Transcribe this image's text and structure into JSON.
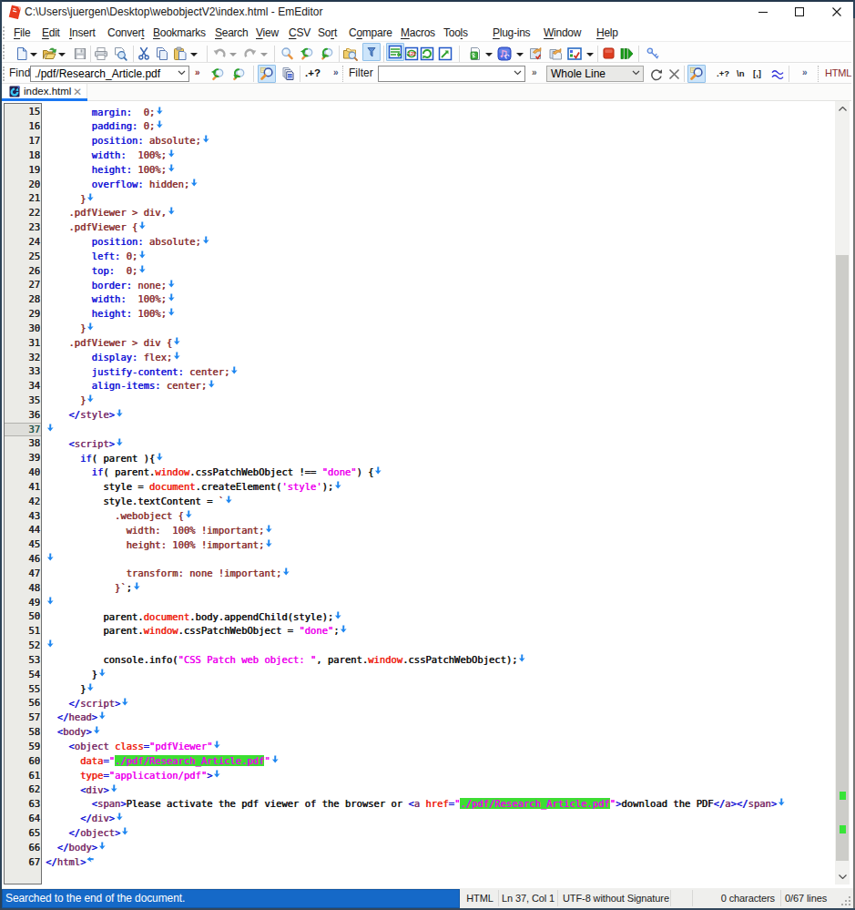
{
  "window": {
    "title": "C:\\Users\\juergen\\Desktop\\webobjectV2\\index.html - EmEditor",
    "controls": [
      "minimize",
      "maximize",
      "close"
    ]
  },
  "menu": {
    "items": [
      {
        "pre": "",
        "key": "F",
        "post": "ile"
      },
      {
        "pre": "",
        "key": "E",
        "post": "dit"
      },
      {
        "pre": "",
        "key": "I",
        "post": "nsert"
      },
      {
        "pre": "Conver",
        "key": "t",
        "post": ""
      },
      {
        "pre": "",
        "key": "B",
        "post": "ookmarks"
      },
      {
        "pre": "",
        "key": "S",
        "post": "earch"
      },
      {
        "pre": "",
        "key": "V",
        "post": "iew"
      },
      {
        "pre": "",
        "key": "C",
        "post": "SV"
      },
      {
        "pre": "So",
        "key": "r",
        "post": "t"
      },
      {
        "pre": "C",
        "key": "o",
        "post": "mpare"
      },
      {
        "pre": "",
        "key": "M",
        "post": "acros"
      },
      {
        "pre": "Too",
        "key": "l",
        "post": "s"
      },
      {
        "pre": "",
        "key": "P",
        "post": "lug-ins"
      },
      {
        "pre": "",
        "key": "W",
        "post": "indow"
      },
      {
        "pre": "",
        "key": "H",
        "post": "elp"
      }
    ]
  },
  "toolbar": {
    "icons": [
      "new-file",
      "open-file",
      "save",
      "print",
      "print-preview",
      "cut",
      "copy",
      "paste",
      "undo",
      "redo",
      "find",
      "find-next",
      "find-previous",
      "find-in-files",
      "filter",
      "wrap-indicator",
      "csv-mode",
      "reload",
      "jump",
      "snippets",
      "macros",
      "record-macro",
      "run-macro",
      "macro-options",
      "stop",
      "pause-run",
      "pin"
    ]
  },
  "findbar": {
    "find_label": "Find",
    "find_value": "./pdf/Research_Article.pdf",
    "filter_label": "Filter",
    "filter_value": "",
    "match_mode": "Whole Line",
    "badge_regex": ".+?",
    "badge_regex2": ".+?",
    "badge_newline": "\\n",
    "badge_brackets": "[,]",
    "syntax_badge": "HTML"
  },
  "tabs": [
    {
      "label": "index.html",
      "active": true
    }
  ],
  "editor": {
    "first_line": 15,
    "current_line": 37,
    "lines": [
      {
        "n": 15,
        "seg": [
          [
            "w",
            "        "
          ],
          [
            "p",
            "margin:"
          ],
          [
            "w",
            "  "
          ],
          [
            "v",
            "0;"
          ]
        ]
      },
      {
        "n": 16,
        "seg": [
          [
            "w",
            "        "
          ],
          [
            "p",
            "padding:"
          ],
          [
            "w",
            " "
          ],
          [
            "v",
            "0;"
          ]
        ]
      },
      {
        "n": 17,
        "seg": [
          [
            "w",
            "        "
          ],
          [
            "p",
            "position:"
          ],
          [
            "w",
            " "
          ],
          [
            "v",
            "absolute;"
          ]
        ]
      },
      {
        "n": 18,
        "seg": [
          [
            "w",
            "        "
          ],
          [
            "p",
            "width:"
          ],
          [
            "w",
            "  "
          ],
          [
            "v",
            "100%;"
          ]
        ]
      },
      {
        "n": 19,
        "seg": [
          [
            "w",
            "        "
          ],
          [
            "p",
            "height:"
          ],
          [
            "w",
            " "
          ],
          [
            "v",
            "100%;"
          ]
        ]
      },
      {
        "n": 20,
        "seg": [
          [
            "w",
            "        "
          ],
          [
            "p",
            "overflow:"
          ],
          [
            "w",
            " "
          ],
          [
            "v",
            "hidden;"
          ]
        ]
      },
      {
        "n": 21,
        "seg": [
          [
            "w",
            "      "
          ],
          [
            "v",
            "}"
          ]
        ]
      },
      {
        "n": 22,
        "seg": [
          [
            "w",
            "    "
          ],
          [
            "v",
            ".pdfViewer > div,"
          ]
        ]
      },
      {
        "n": 23,
        "seg": [
          [
            "w",
            "    "
          ],
          [
            "v",
            ".pdfViewer {"
          ]
        ]
      },
      {
        "n": 24,
        "seg": [
          [
            "w",
            "        "
          ],
          [
            "p",
            "position:"
          ],
          [
            "w",
            " "
          ],
          [
            "v",
            "absolute;"
          ]
        ]
      },
      {
        "n": 25,
        "seg": [
          [
            "w",
            "        "
          ],
          [
            "p",
            "left:"
          ],
          [
            "w",
            " "
          ],
          [
            "v",
            "0;"
          ]
        ]
      },
      {
        "n": 26,
        "seg": [
          [
            "w",
            "        "
          ],
          [
            "p",
            "top:"
          ],
          [
            "w",
            "  "
          ],
          [
            "v",
            "0;"
          ]
        ]
      },
      {
        "n": 27,
        "seg": [
          [
            "w",
            "        "
          ],
          [
            "p",
            "border:"
          ],
          [
            "w",
            " "
          ],
          [
            "v",
            "none;"
          ]
        ]
      },
      {
        "n": 28,
        "seg": [
          [
            "w",
            "        "
          ],
          [
            "p",
            "width:"
          ],
          [
            "w",
            "  "
          ],
          [
            "v",
            "100%;"
          ]
        ]
      },
      {
        "n": 29,
        "seg": [
          [
            "w",
            "        "
          ],
          [
            "p",
            "height:"
          ],
          [
            "w",
            " "
          ],
          [
            "v",
            "100%;"
          ]
        ]
      },
      {
        "n": 30,
        "seg": [
          [
            "w",
            "      "
          ],
          [
            "v",
            "}"
          ]
        ]
      },
      {
        "n": 31,
        "seg": [
          [
            "w",
            "    "
          ],
          [
            "v",
            ".pdfViewer > div {"
          ]
        ]
      },
      {
        "n": 32,
        "seg": [
          [
            "w",
            "        "
          ],
          [
            "p",
            "display:"
          ],
          [
            "w",
            " "
          ],
          [
            "v",
            "flex;"
          ]
        ]
      },
      {
        "n": 33,
        "seg": [
          [
            "w",
            "        "
          ],
          [
            "p",
            "justify-content:"
          ],
          [
            "w",
            " "
          ],
          [
            "v",
            "center;"
          ]
        ]
      },
      {
        "n": 34,
        "seg": [
          [
            "w",
            "        "
          ],
          [
            "p",
            "align-items:"
          ],
          [
            "w",
            " "
          ],
          [
            "v",
            "center;"
          ]
        ]
      },
      {
        "n": 35,
        "seg": [
          [
            "w",
            "      "
          ],
          [
            "v",
            "}"
          ]
        ]
      },
      {
        "n": 36,
        "seg": [
          [
            "w",
            "    "
          ],
          [
            "p",
            "</"
          ],
          [
            "t",
            "style"
          ],
          [
            "p",
            ">"
          ]
        ]
      },
      {
        "n": 37,
        "seg": []
      },
      {
        "n": 38,
        "seg": [
          [
            "w",
            "    "
          ],
          [
            "p",
            "<"
          ],
          [
            "t",
            "script"
          ],
          [
            "p",
            ">"
          ]
        ]
      },
      {
        "n": 39,
        "seg": [
          [
            "w",
            "      "
          ],
          [
            "p",
            "if"
          ],
          [
            "b",
            "( parent ){"
          ]
        ]
      },
      {
        "n": 40,
        "seg": [
          [
            "w",
            "        "
          ],
          [
            "p",
            "if"
          ],
          [
            "b",
            "( parent."
          ],
          [
            "r",
            "window"
          ],
          [
            "b",
            ".cssPatchWebObject !== "
          ],
          [
            "s",
            "\"done\""
          ],
          [
            "b",
            ") {"
          ]
        ]
      },
      {
        "n": 41,
        "seg": [
          [
            "w",
            "          "
          ],
          [
            "b",
            "style = "
          ],
          [
            "r",
            "document"
          ],
          [
            "b",
            ".createElement("
          ],
          [
            "s",
            "'style'"
          ],
          [
            "b",
            ");"
          ]
        ]
      },
      {
        "n": 42,
        "seg": [
          [
            "w",
            "          "
          ],
          [
            "b",
            "style.textContent = "
          ],
          [
            "v",
            "`"
          ]
        ]
      },
      {
        "n": 43,
        "seg": [
          [
            "w",
            "            "
          ],
          [
            "v",
            ".webobject {"
          ]
        ]
      },
      {
        "n": 44,
        "seg": [
          [
            "w",
            "              "
          ],
          [
            "v",
            "width:  100% !important;"
          ]
        ]
      },
      {
        "n": 45,
        "seg": [
          [
            "w",
            "              "
          ],
          [
            "v",
            "height: 100% !important;"
          ]
        ]
      },
      {
        "n": 46,
        "seg": []
      },
      {
        "n": 47,
        "seg": [
          [
            "w",
            "              "
          ],
          [
            "v",
            "transform: none !important;"
          ]
        ]
      },
      {
        "n": 48,
        "seg": [
          [
            "w",
            "            "
          ],
          [
            "v",
            "}`"
          ],
          [
            "b",
            ";"
          ]
        ]
      },
      {
        "n": 49,
        "seg": []
      },
      {
        "n": 50,
        "seg": [
          [
            "w",
            "          "
          ],
          [
            "b",
            "parent."
          ],
          [
            "r",
            "document"
          ],
          [
            "b",
            ".body.appendChild(style);"
          ]
        ]
      },
      {
        "n": 51,
        "seg": [
          [
            "w",
            "          "
          ],
          [
            "b",
            "parent."
          ],
          [
            "r",
            "window"
          ],
          [
            "b",
            ".cssPatchWebObject = "
          ],
          [
            "s",
            "\"done\""
          ],
          [
            "b",
            ";"
          ]
        ]
      },
      {
        "n": 52,
        "seg": []
      },
      {
        "n": 53,
        "seg": [
          [
            "w",
            "          "
          ],
          [
            "b",
            "console.info("
          ],
          [
            "s",
            "\"CSS Patch web object: \""
          ],
          [
            "b",
            ", parent."
          ],
          [
            "r",
            "window"
          ],
          [
            "b",
            ".cssPatchWebObject);"
          ]
        ]
      },
      {
        "n": 54,
        "seg": [
          [
            "w",
            "        "
          ],
          [
            "b",
            "}"
          ]
        ]
      },
      {
        "n": 55,
        "seg": [
          [
            "w",
            "      "
          ],
          [
            "b",
            "}"
          ]
        ]
      },
      {
        "n": 56,
        "seg": [
          [
            "w",
            "    "
          ],
          [
            "p",
            "</"
          ],
          [
            "t",
            "script"
          ],
          [
            "p",
            ">"
          ]
        ]
      },
      {
        "n": 57,
        "seg": [
          [
            "w",
            "  "
          ],
          [
            "p",
            "</"
          ],
          [
            "t",
            "head"
          ],
          [
            "p",
            ">"
          ]
        ]
      },
      {
        "n": 58,
        "seg": [
          [
            "w",
            "  "
          ],
          [
            "p",
            "<"
          ],
          [
            "t",
            "body"
          ],
          [
            "p",
            ">"
          ]
        ]
      },
      {
        "n": 59,
        "seg": [
          [
            "w",
            "    "
          ],
          [
            "p",
            "<"
          ],
          [
            "t",
            "object"
          ],
          [
            "b",
            " "
          ],
          [
            "r",
            "class"
          ],
          [
            "p",
            "="
          ],
          [
            "s",
            "\"pdfViewer\""
          ]
        ]
      },
      {
        "n": 60,
        "seg": [
          [
            "w",
            "      "
          ],
          [
            "r",
            "data"
          ],
          [
            "p",
            "="
          ],
          [
            "s",
            "\""
          ],
          [
            "g",
            "./pdf/Research_Article.pdf"
          ],
          [
            "s",
            "\""
          ]
        ]
      },
      {
        "n": 61,
        "seg": [
          [
            "w",
            "      "
          ],
          [
            "r",
            "type"
          ],
          [
            "p",
            "="
          ],
          [
            "s",
            "\"application/pdf\""
          ],
          [
            "p",
            ">"
          ]
        ]
      },
      {
        "n": 62,
        "seg": [
          [
            "w",
            "      "
          ],
          [
            "p",
            "<"
          ],
          [
            "t",
            "div"
          ],
          [
            "p",
            ">"
          ]
        ]
      },
      {
        "n": 63,
        "seg": [
          [
            "w",
            "        "
          ],
          [
            "p",
            "<"
          ],
          [
            "t",
            "span"
          ],
          [
            "p",
            ">"
          ],
          [
            "b",
            "Please activate the pdf viewer of the browser or "
          ],
          [
            "p",
            "<"
          ],
          [
            "t",
            "a"
          ],
          [
            "b",
            " "
          ],
          [
            "r",
            "href"
          ],
          [
            "p",
            "="
          ],
          [
            "s",
            "\""
          ],
          [
            "g",
            "./pdf/Research_Article.pdf"
          ],
          [
            "s",
            "\""
          ],
          [
            "p",
            ">"
          ],
          [
            "b",
            "download the PDF"
          ],
          [
            "p",
            "</"
          ],
          [
            "t",
            "a"
          ],
          [
            "p",
            ">"
          ],
          [
            "p",
            "</"
          ],
          [
            "t",
            "span"
          ],
          [
            "p",
            ">"
          ]
        ]
      },
      {
        "n": 64,
        "seg": [
          [
            "w",
            "      "
          ],
          [
            "p",
            "</"
          ],
          [
            "t",
            "div"
          ],
          [
            "p",
            ">"
          ]
        ]
      },
      {
        "n": 65,
        "seg": [
          [
            "w",
            "    "
          ],
          [
            "p",
            "</"
          ],
          [
            "t",
            "object"
          ],
          [
            "p",
            ">"
          ]
        ]
      },
      {
        "n": 66,
        "seg": [
          [
            "w",
            "  "
          ],
          [
            "p",
            "</"
          ],
          [
            "t",
            "body"
          ],
          [
            "p",
            ">"
          ]
        ]
      },
      {
        "n": 67,
        "seg": [
          [
            "p",
            "</"
          ],
          [
            "t",
            "html"
          ],
          [
            "p",
            ">"
          ]
        ],
        "eof": true
      }
    ]
  },
  "scrollbar": {
    "markers_lines": [
      60,
      63
    ]
  },
  "status": {
    "message": "Searched to the end of the document.",
    "syntax": "HTML",
    "position": "Ln 37, Col 1",
    "encoding": "UTF-8 without Signature",
    "chars": "0 characters",
    "lines": "0/67 lines"
  }
}
